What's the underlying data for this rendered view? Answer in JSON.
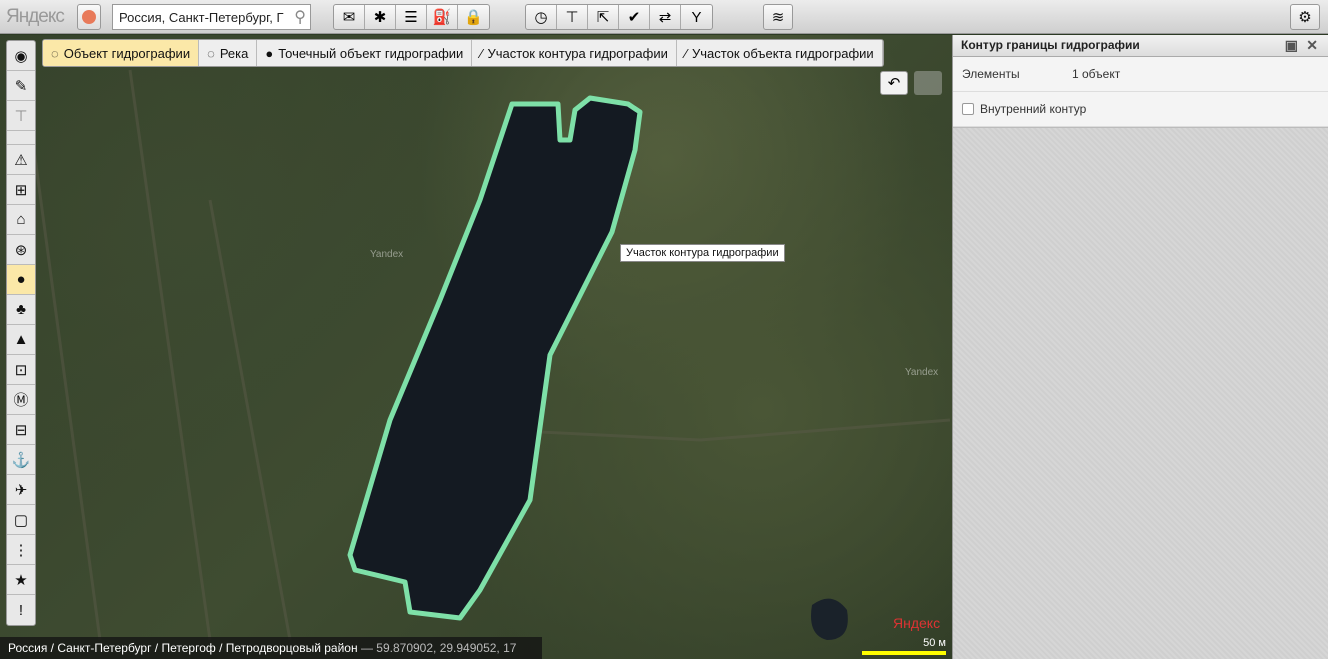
{
  "topbar": {
    "logo": "Яндекс",
    "search_value": "Россия, Санкт-Петербург, Г",
    "group1": [
      "✉",
      "✱",
      "☰",
      "⛽",
      "🔒"
    ],
    "group2": [
      "◷",
      "⊤",
      "⇱",
      "✔",
      "⇄",
      "Y"
    ],
    "layers": "≋",
    "settings": "⚙"
  },
  "left_toolbar": [
    "◉",
    "✎",
    "⊤",
    "",
    "⚠",
    "⊞",
    "⌂",
    "⊛",
    "●",
    "♣",
    "▲",
    "⊡",
    "Ⓜ",
    "⊟",
    "⚓",
    "✈",
    "▢",
    "⋮",
    "★",
    "!"
  ],
  "tabs": [
    {
      "label": "Объект гидрографии",
      "icon": "◌"
    },
    {
      "label": "Река",
      "icon": "◌"
    },
    {
      "label": "Точечный объект гидрографии",
      "icon": "●"
    },
    {
      "label": "Участок контура гидрографии",
      "icon": "⁄"
    },
    {
      "label": "Участок объекта гидрографии",
      "icon": "⁄"
    }
  ],
  "map": {
    "tooltip": "Участок контура гидрографии",
    "watermark": "Yandex",
    "breadcrumb": "Россия / Санкт-Петербург / Петергоф / Петродворцовый район",
    "coords": "— 59.870902, 29.949052, 17",
    "scale": "50 м",
    "logo": "Яндекс",
    "undo": "↶"
  },
  "panel": {
    "title": "Контур границы гидрографии",
    "elements_label": "Элементы",
    "elements_value": "1 объект",
    "inner_contour_label": "Внутренний контур",
    "inner_contour_checked": false
  },
  "colors": {
    "outline": "#7ee0a8",
    "lake": "#141a22"
  }
}
